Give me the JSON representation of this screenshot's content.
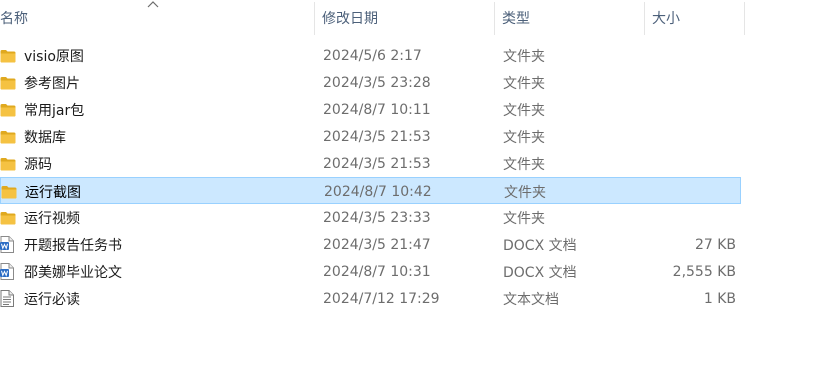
{
  "header": {
    "name_label": "名称",
    "date_label": "修改日期",
    "type_label": "类型",
    "size_label": "大小",
    "sort_direction": "ascending"
  },
  "colors": {
    "folder": "#f5c242",
    "folder_dark": "#e0a91f",
    "selection_bg": "#cce8ff",
    "selection_border": "#99d1ff",
    "doc_blue": "#2b6cc4"
  },
  "files": [
    {
      "name": "visio原图",
      "date": "2024/5/6 2:17",
      "type": "文件夹",
      "size": "",
      "icon": "folder-icon",
      "selected": false
    },
    {
      "name": "参考图片",
      "date": "2024/3/5 23:28",
      "type": "文件夹",
      "size": "",
      "icon": "folder-icon",
      "selected": false
    },
    {
      "name": "常用jar包",
      "date": "2024/8/7 10:11",
      "type": "文件夹",
      "size": "",
      "icon": "folder-icon",
      "selected": false
    },
    {
      "name": "数据库",
      "date": "2024/3/5 21:53",
      "type": "文件夹",
      "size": "",
      "icon": "folder-icon",
      "selected": false
    },
    {
      "name": "源码",
      "date": "2024/3/5 21:53",
      "type": "文件夹",
      "size": "",
      "icon": "folder-icon",
      "selected": false
    },
    {
      "name": "运行截图",
      "date": "2024/8/7 10:42",
      "type": "文件夹",
      "size": "",
      "icon": "folder-icon",
      "selected": true
    },
    {
      "name": "运行视频",
      "date": "2024/3/5 23:33",
      "type": "文件夹",
      "size": "",
      "icon": "folder-icon",
      "selected": false
    },
    {
      "name": "开题报告任务书",
      "date": "2024/3/5 21:47",
      "type": "DOCX 文档",
      "size": "27 KB",
      "icon": "word-document-icon",
      "selected": false
    },
    {
      "name": "邵美娜毕业论文",
      "date": "2024/8/7 10:31",
      "type": "DOCX 文档",
      "size": "2,555 KB",
      "icon": "word-document-icon",
      "selected": false
    },
    {
      "name": "运行必读",
      "date": "2024/7/12 17:29",
      "type": "文本文档",
      "size": "1 KB",
      "icon": "text-document-icon",
      "selected": false
    }
  ]
}
